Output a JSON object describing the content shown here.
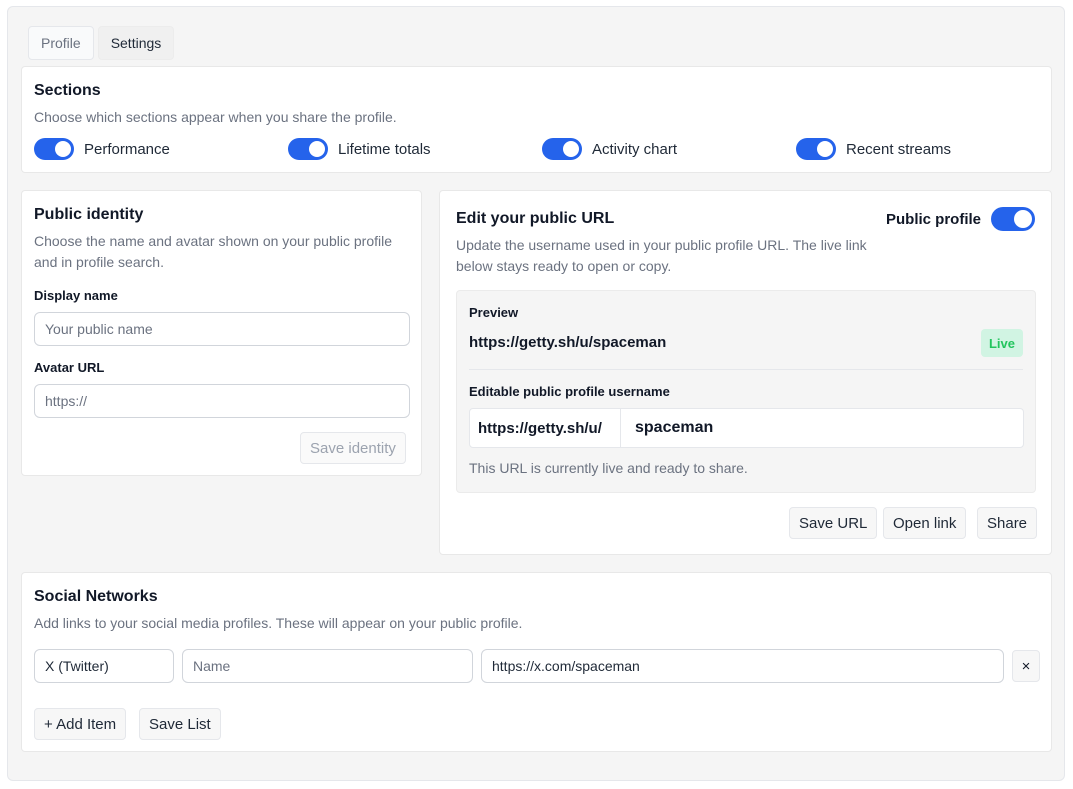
{
  "tabs": [
    {
      "label": "Profile"
    },
    {
      "label": "Settings"
    }
  ],
  "sections": {
    "title": "Sections",
    "description": "Choose which sections appear when you share the profile.",
    "items": [
      {
        "label": "Performance",
        "enabled": true
      },
      {
        "label": "Lifetime totals",
        "enabled": true
      },
      {
        "label": "Activity chart",
        "enabled": true
      },
      {
        "label": "Recent streams",
        "enabled": true
      }
    ]
  },
  "identity": {
    "title": "Public identity",
    "description": "Choose the name and avatar shown on your public profile and in profile search.",
    "display_name_label": "Display name",
    "display_name_placeholder": "Your public name",
    "avatar_label": "Avatar URL",
    "avatar_placeholder": "https://",
    "save_label": "Save identity"
  },
  "url_card": {
    "title": "Edit your public URL",
    "public_profile_label": "Public profile",
    "public_profile_enabled": true,
    "description": "Update the username used in your public profile URL. The live link below stays ready to open or copy.",
    "preview_label": "Preview",
    "preview_url": "https://getty.sh/u/spaceman",
    "live_badge": "Live",
    "username_label": "Editable public profile username",
    "url_prefix": "https://getty.sh/u/",
    "username_value": "spaceman",
    "status_text": "This URL is currently live and ready to share.",
    "save_url_label": "Save URL",
    "open_link_label": "Open link",
    "share_label": "Share"
  },
  "social": {
    "title": "Social Networks",
    "description": "Add links to your social media profiles. These will appear on your public profile.",
    "rows": [
      {
        "network": "X (Twitter)",
        "name_placeholder": "Name",
        "url": "https://x.com/spaceman",
        "remove_glyph": "×"
      }
    ],
    "add_label": "+ Add Item",
    "save_label": "Save List"
  },
  "colors": {
    "accent": "#2563eb",
    "live_bg": "#d1f4e3",
    "live_text": "#22c55e"
  }
}
